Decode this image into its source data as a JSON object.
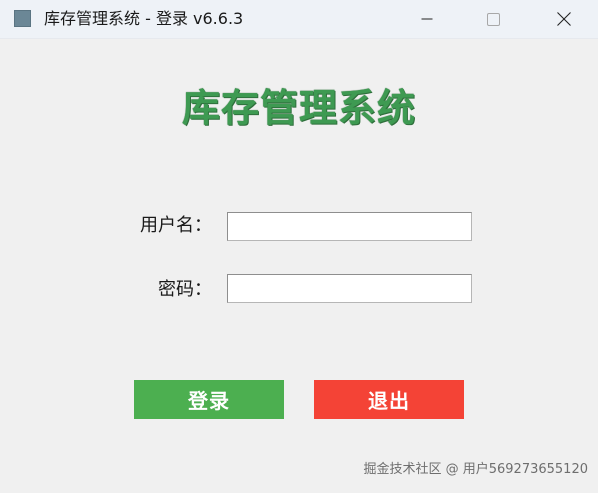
{
  "window": {
    "title": "库存管理系统 - 登录  v6.6.3",
    "icon": "app-icon",
    "controls": {
      "minimize": "minimize-icon",
      "maximize": "maximize-icon",
      "close": "close-icon"
    }
  },
  "main": {
    "heading": "库存管理系统",
    "heading_color": "#3e9a52"
  },
  "form": {
    "username_label": "用户名：",
    "username_value": "",
    "username_placeholder": "",
    "password_label": "密码：",
    "password_value": "",
    "password_placeholder": ""
  },
  "buttons": {
    "login_label": "登录",
    "login_color": "#4caf50",
    "exit_label": "退出",
    "exit_color": "#f44336"
  },
  "watermark": "掘金技术社区 @ 用户569273655120"
}
